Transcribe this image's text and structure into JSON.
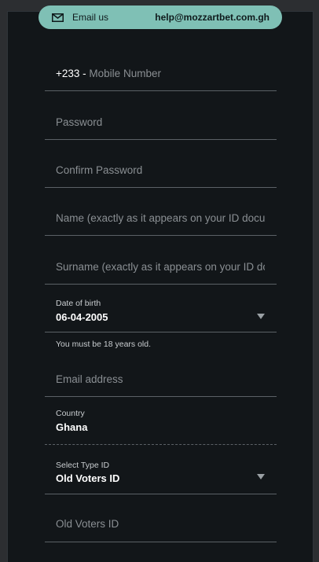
{
  "contact": {
    "label": "Email us",
    "email": "help@mozzartbet.com.gh"
  },
  "form": {
    "mobile": {
      "prefix": "+233",
      "placeholder": "Mobile Number"
    },
    "password": {
      "placeholder": "Password"
    },
    "confirm_password": {
      "placeholder": "Confirm Password"
    },
    "name": {
      "placeholder": "Name (exactly as it appears on your ID document)"
    },
    "surname": {
      "placeholder": "Surname (exactly as it appears on your ID document)"
    },
    "dob": {
      "label": "Date of birth",
      "value": "06-04-2005",
      "hint": "You must be 18 years old."
    },
    "email": {
      "placeholder": "Email address"
    },
    "country": {
      "label": "Country",
      "value": "Ghana"
    },
    "id_type": {
      "label": "Select Type ID",
      "value": "Old Voters ID"
    },
    "id_number": {
      "placeholder": "Old Voters ID"
    }
  },
  "colors": {
    "background": "#121619",
    "accent": "#7fc0b5",
    "divider": "#5b6166"
  }
}
